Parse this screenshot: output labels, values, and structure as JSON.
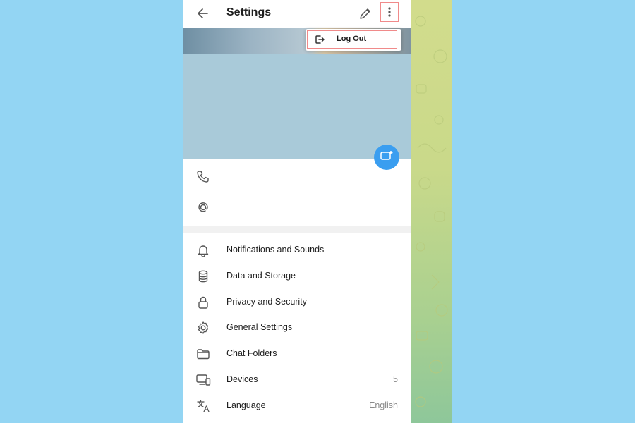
{
  "header": {
    "title": "Settings",
    "back_icon": "arrow-left-icon",
    "edit_icon": "pencil-icon",
    "more_icon": "more-vertical-icon"
  },
  "dropdown": {
    "items": [
      {
        "label": "Log Out",
        "icon": "logout-icon"
      }
    ]
  },
  "profile": {
    "fab_icon": "add-photo-icon",
    "info_icons": [
      "phone-icon",
      "at-sign-icon"
    ]
  },
  "menu": {
    "items": [
      {
        "label": "Notifications and Sounds",
        "value": "",
        "icon": "bell-icon"
      },
      {
        "label": "Data and Storage",
        "value": "",
        "icon": "database-icon"
      },
      {
        "label": "Privacy and Security",
        "value": "",
        "icon": "lock-icon"
      },
      {
        "label": "General Settings",
        "value": "",
        "icon": "gear-icon"
      },
      {
        "label": "Chat Folders",
        "value": "",
        "icon": "folder-icon"
      },
      {
        "label": "Devices",
        "value": "5",
        "icon": "devices-icon"
      },
      {
        "label": "Language",
        "value": "English",
        "icon": "translate-icon"
      }
    ]
  },
  "colors": {
    "page_background": "#93d5f3",
    "accent": "#3a9ef0",
    "highlight_border": "#f08a8a",
    "cover_placeholder": "#a9cad9"
  }
}
